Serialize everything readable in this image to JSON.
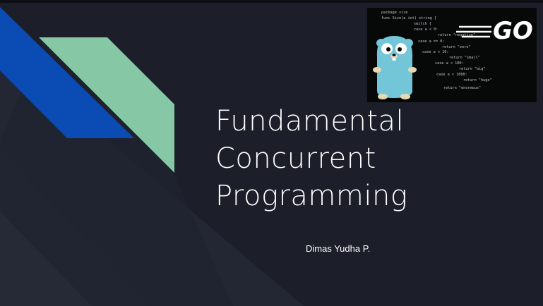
{
  "slide": {
    "title_lines": [
      "Fundamental",
      "Concurrent",
      "Programming"
    ],
    "author": "Dimas Yudha P."
  },
  "hero_image": {
    "logo_text": "GO",
    "mascot": "gopher",
    "code_lines": [
      "package size",
      "func Size(a int) string {",
      "switch {",
      "case a < 0:",
      "return \"negative\"",
      "case a == 0:",
      "return \"zero\"",
      "case a < 10:",
      "return \"small\"",
      "case a < 100:",
      "return \"big\"",
      "case a < 1000:",
      "return \"huge\"",
      "return \"enormous\""
    ]
  },
  "colors": {
    "background": "#1c1f29",
    "blue_band": "#0a4bb4",
    "green_band": "#86c8a5",
    "title_text": "#ffffff",
    "gopher": "#73c6d8",
    "code_text": "#d7e3e6"
  }
}
